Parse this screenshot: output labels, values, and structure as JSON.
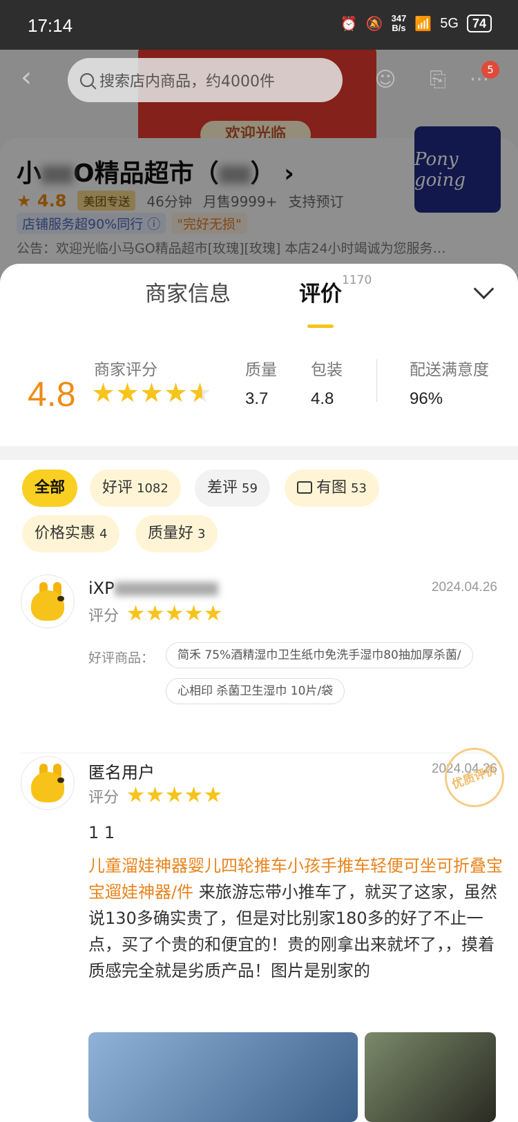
{
  "status_bar": {
    "time": "17:14",
    "net_speed": "347\nB/s",
    "network": "5G",
    "battery": "74"
  },
  "nav": {
    "search_placeholder": "搜索店内商品，约4000件",
    "badge": "5"
  },
  "store": {
    "name_prefix": "小",
    "name_suffix": "O精品超市（",
    "name_end": "）",
    "rating": "4.8",
    "delivery_tag": "美团专送",
    "delivery_time": "46分钟",
    "monthly_sales": "月售9999+",
    "preorder": "支持预订",
    "badge_service": "店铺服务超90%同行",
    "badge_intact": "\"完好无损\"",
    "notice": "公告：欢迎光临小马GO精品超市[玫瑰][玫瑰] 本店24小时竭诚为您服务…",
    "logo_text": "Pony going",
    "banner_text": "欢迎光临"
  },
  "sheet": {
    "tab_merchant": "商家信息",
    "tab_reviews": "评价",
    "review_count": "1170",
    "merchant_score_label": "商家评分",
    "merchant_score": "4.8",
    "merchant_stars": 4.8,
    "metrics": [
      {
        "label": "质量",
        "value": "3.7"
      },
      {
        "label": "包装",
        "value": "4.8"
      },
      {
        "label": "配送满意度",
        "value": "96%"
      }
    ],
    "filters": [
      {
        "label": "全部",
        "count": ""
      },
      {
        "label": "好评",
        "count": "1082"
      },
      {
        "label": "差评",
        "count": "59"
      },
      {
        "label": "有图",
        "count": "53"
      },
      {
        "label": "价格实惠",
        "count": "4"
      },
      {
        "label": "质量好",
        "count": "3"
      }
    ]
  },
  "reviews": [
    {
      "user": "iXP",
      "date": "2024.04.26",
      "score_label": "评分",
      "stars": 5,
      "goods_label": "好评商品：",
      "goods": [
        "简禾 75%酒精湿巾卫生纸巾免洗手湿巾80抽加厚杀菌/",
        "心相印 杀菌卫生湿巾 10片/袋"
      ]
    },
    {
      "user": "匿名用户",
      "date": "2024.04.26",
      "score_label": "评分",
      "stars": 5,
      "stamp": "优质评价",
      "text_short": "1 1",
      "product_link": "儿童溜娃神器婴儿四轮推车小孩手推车轻便可坐可折叠宝宝遛娃神器/件",
      "body": " 来旅游忘带小推车了，就买了这家，虽然说130多确实贵了，但是对比别家180多的好了不止一点，买了个贵的和便宜的！贵的刚拿出来就坏了，，摸着质感完全就是劣质产品！图片是别家的"
    }
  ]
}
